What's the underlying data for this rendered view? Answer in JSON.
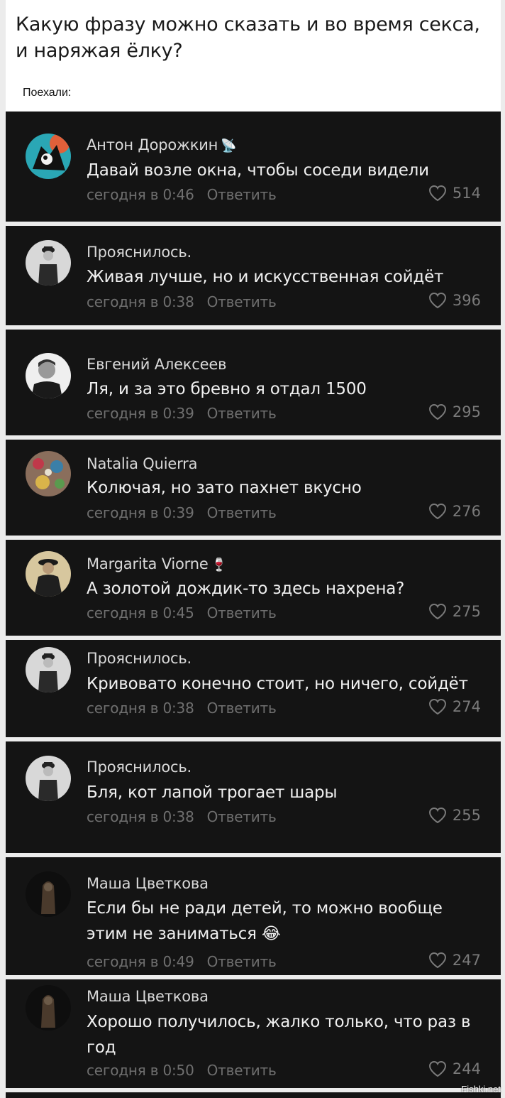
{
  "post": {
    "question": "Какую фразу можно сказать и во время секса, и наряжая ёлку?",
    "intro": "Поехали:"
  },
  "reply_label": "Ответить",
  "comments": [
    {
      "author": "Антон Дорожкин",
      "badge": "📡",
      "text": "Давай возле окна, чтобы соседи видели",
      "time": "сегодня в 0:46",
      "likes": "514"
    },
    {
      "author": "Прояснилось.",
      "text": "Живая лучше, но и искусственная сойдёт",
      "time": "сегодня в 0:38",
      "likes": "396"
    },
    {
      "author": "Евгений Алексеев",
      "text": "Ля, и за это бревно я отдал 1500",
      "time": "сегодня в 0:39",
      "likes": "295"
    },
    {
      "author": "Natalia Quierra",
      "text": "Колючая, но зато пахнет вкусно",
      "time": "сегодня в 0:39",
      "likes": "276"
    },
    {
      "author": "Margarita Viorne",
      "badge": "🍷",
      "text": "А золотой дождик-то здесь нахрена?",
      "time": "сегодня в 0:45",
      "likes": "275"
    },
    {
      "author": "Прояснилось.",
      "text": "Кривовато конечно стоит, но ничего, сойдёт",
      "time": "сегодня в 0:38",
      "likes": "274"
    },
    {
      "author": "Прояснилось.",
      "text": "Бля, кот лапой трогает шары",
      "time": "сегодня в 0:38",
      "likes": "255"
    },
    {
      "author": "Маша Цветкова",
      "text": "Если бы не ради детей, то можно вообще этим не заниматься 😂",
      "time": "сегодня в 0:49",
      "likes": "247"
    },
    {
      "author": "Маша Цветкова",
      "text": "Хорошо получилось, жалко только, что раз в год",
      "time": "сегодня в 0:50",
      "likes": "244"
    }
  ],
  "watermark": "Fishki.net"
}
